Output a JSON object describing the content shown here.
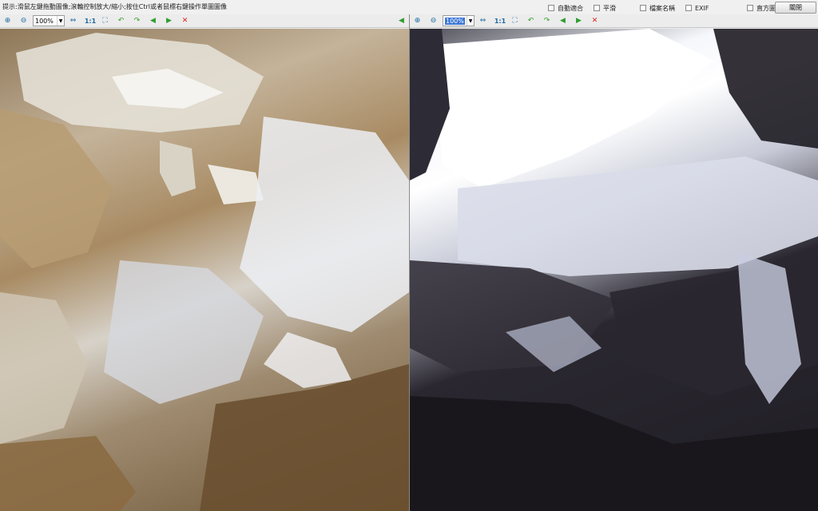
{
  "hint": "提示:滑鼠左鍵拖動圖像;滾輪控制放大/縮小;按住Ctrl或者鼠標右鍵操作單圖圖像",
  "options": [
    {
      "label": "自動適合",
      "checked": false
    },
    {
      "label": "平滑",
      "checked": false
    },
    {
      "label": "檔案名稱",
      "checked": false
    },
    {
      "label": "EXIF",
      "checked": false
    },
    {
      "label": "直方圖",
      "checked": false
    }
  ],
  "close_label": "關閉",
  "left_toolbar": {
    "zoom": "100%",
    "one_to_one": "1:1"
  },
  "right_toolbar": {
    "zoom": "100%",
    "one_to_one": "1:1"
  },
  "icons": {
    "zoom_in": "zoom-in-icon",
    "zoom_out": "zoom-out-icon",
    "fit": "fit-icon",
    "actual_size": "actual-size-icon",
    "rotate_left": "rotate-left-icon",
    "rotate_right": "rotate-right-icon",
    "prev": "previous-icon",
    "next": "next-icon",
    "close": "close-icon",
    "sync": "sync-arrow-icon"
  },
  "colors": {
    "accent_blue": "#1c6aa3",
    "close_red": "#d8201b",
    "green": "#2f9e2f",
    "selection": "#3a76d6"
  }
}
